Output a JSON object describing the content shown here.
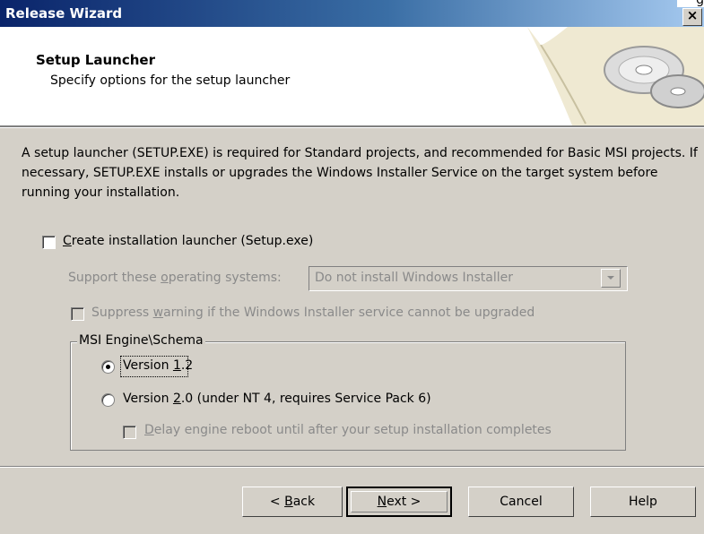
{
  "window": {
    "title": "Release Wizard",
    "corner_glyph": "g",
    "close_glyph": "×"
  },
  "header": {
    "title": "Setup Launcher",
    "subtitle": "Specify options for the setup launcher"
  },
  "description": "A setup launcher (SETUP.EXE) is required for Standard projects, and recommended for Basic MSI projects. If necessary, SETUP.EXE installs or upgrades the Windows Installer Service on the target system before running your installation.",
  "create_launcher": {
    "label_prefix": "C",
    "label_rest": "reate installation launcher (Setup.exe)",
    "checked": false
  },
  "os_support": {
    "label_a": "Support these ",
    "label_u": "o",
    "label_b": "perating systems:",
    "selected": "Do not install Windows Installer"
  },
  "suppress_warning": {
    "label_a": "Suppress ",
    "label_u": "w",
    "label_b": "arning if the Windows Installer service cannot be upgraded",
    "checked": false
  },
  "msi_group": {
    "label": "MSI Engine\\Schema",
    "v12": {
      "a": "Version ",
      "u": "1",
      "b": ".2",
      "selected": true
    },
    "v20": {
      "a": "Version ",
      "u": "2",
      "b": ".0 (under NT 4, requires Service Pack 6)",
      "selected": false
    },
    "delay": {
      "u": "D",
      "b": "elay engine reboot until after your setup installation completes",
      "checked": false
    }
  },
  "buttons": {
    "back_a": "< ",
    "back_u": "B",
    "back_b": "ack",
    "next_u": "N",
    "next_b": "ext >",
    "cancel": "Cancel",
    "help": "Help"
  },
  "colors": {
    "title_bar": "#0a246a",
    "dialog_face": "#d4d0c8",
    "disabled_text": "#8a8a8a"
  }
}
